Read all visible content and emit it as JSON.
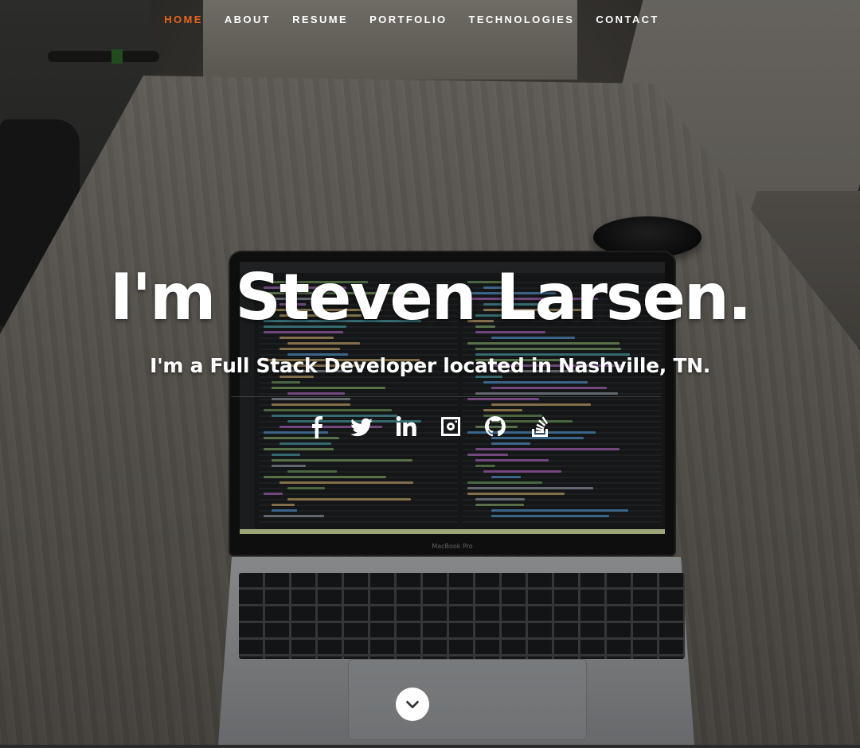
{
  "nav": {
    "items": [
      {
        "label": "HOME",
        "active": true
      },
      {
        "label": "ABOUT"
      },
      {
        "label": "RESUME"
      },
      {
        "label": "PORTFOLIO"
      },
      {
        "label": "TECHNOLOGIES"
      },
      {
        "label": "CONTACT"
      }
    ]
  },
  "hero": {
    "headline": "I'm Steven Larsen.",
    "subheadline": "I'm a Full Stack Developer located in Nashville, TN."
  },
  "social": [
    "facebook-icon",
    "twitter-icon",
    "linkedin-icon",
    "instagram-icon",
    "github-icon",
    "stackoverflow-icon"
  ],
  "laptop": {
    "brand": "MacBook Pro"
  },
  "colors": {
    "accent": "#e8651b",
    "text": "#ffffff"
  }
}
